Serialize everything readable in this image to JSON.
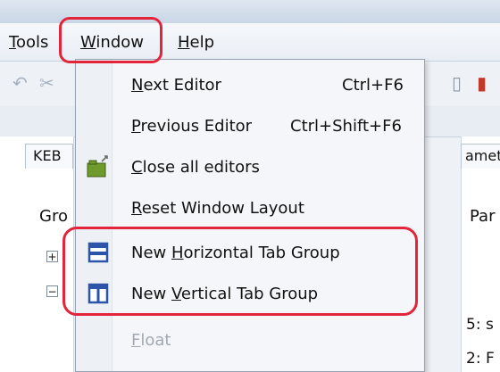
{
  "menubar": {
    "tools": {
      "underline": "T",
      "rest": "ools"
    },
    "window": {
      "underline": "W",
      "rest": "indow"
    },
    "help": {
      "underline": "H",
      "rest": "elp"
    }
  },
  "background": {
    "tab_left": "KEB",
    "tab_right": "amete",
    "col_left": "Gro",
    "col_right": "Par",
    "right_rows": [
      "5: s",
      "2: F"
    ]
  },
  "window_menu": {
    "items": [
      {
        "pre": "",
        "u": "N",
        "post": "ext Editor",
        "shortcut": "Ctrl+F6",
        "icon": ""
      },
      {
        "pre": "",
        "u": "P",
        "post": "revious Editor",
        "shortcut": "Ctrl+Shift+F6",
        "icon": ""
      },
      {
        "pre": "",
        "u": "C",
        "post": "lose all editors",
        "shortcut": "",
        "icon": "close-all-editors-icon"
      },
      {
        "pre": "",
        "u": "R",
        "post": "eset Window Layout",
        "shortcut": "",
        "icon": ""
      },
      {
        "pre": "New ",
        "u": "H",
        "post": "orizontal Tab Group",
        "shortcut": "",
        "icon": "horizontal-tab-group-icon"
      },
      {
        "pre": "New ",
        "u": "V",
        "post": "ertical Tab Group",
        "shortcut": "",
        "icon": "vertical-tab-group-icon"
      },
      {
        "pre": "",
        "u": "F",
        "post": "loat",
        "shortcut": "",
        "icon": "",
        "disabled": true
      }
    ]
  },
  "colors": {
    "highlight": "#e2253a",
    "icon_blue": "#2c54a8",
    "icon_green": "#6f9a2c",
    "disabled_text": "#a2a9b3"
  }
}
